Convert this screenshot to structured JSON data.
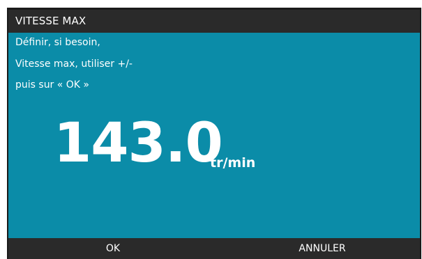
{
  "window": {
    "title": "VITESSE MAX"
  },
  "instructions": {
    "line1": "Définir, si besoin,",
    "line2": "Vitesse max, utiliser +/-",
    "line3": "puis sur « OK »"
  },
  "reading": {
    "value": "143.0",
    "unit": "tr/min"
  },
  "softkeys": {
    "ok_label": "OK",
    "cancel_label": "ANNULER"
  },
  "colors": {
    "content_background": "#0b8ca8",
    "bar_background": "#2a2a2a",
    "text": "#ffffff"
  }
}
